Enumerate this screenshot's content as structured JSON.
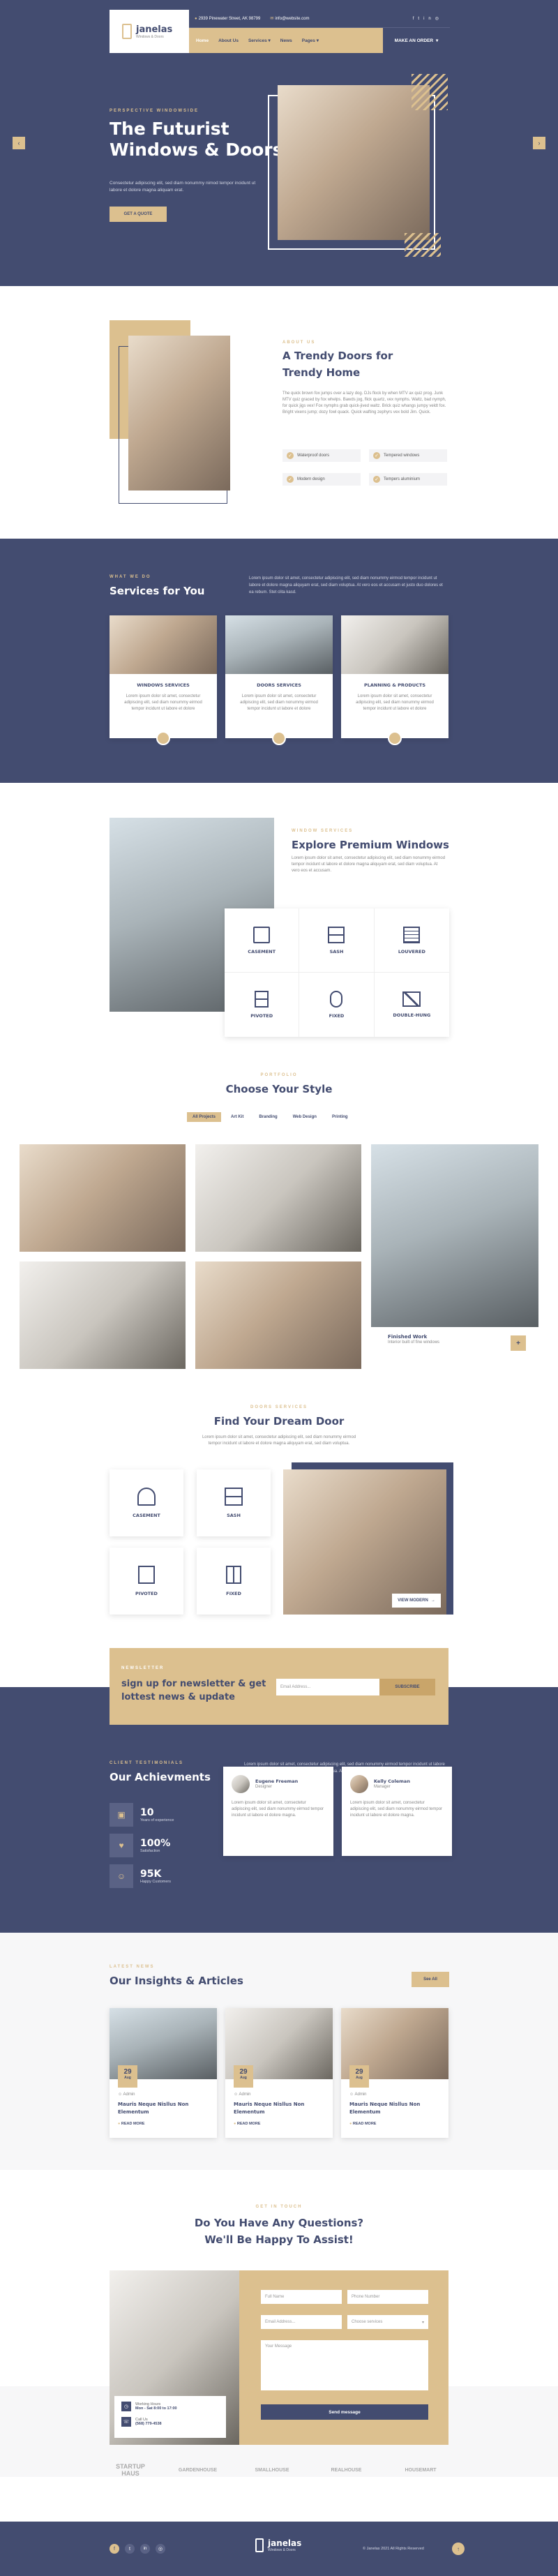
{
  "header": {
    "address": "2939 Pinewater Street, AK 98799",
    "email": "info@website.com",
    "logo_name": "janelas",
    "logo_tag": "Windows & Doors",
    "nav": [
      "Home",
      "About Us",
      "Services",
      "News",
      "Pages"
    ],
    "cta": "MAKE AN ORDER"
  },
  "hero": {
    "eyebrow": "PERSPECTIVE WINDOWSIDE",
    "title_line1": "The Futurist",
    "title_line2": "Windows & Doors",
    "text": "Consectetur adipiscing elit, sed diam nonummy nimod tempor incidunt ut labore et dolore magna aliquam erat.",
    "button": "GET A QUOTE"
  },
  "about": {
    "eyebrow": "ABOUT US",
    "title_line1": "A Trendy Doors for",
    "title_line2": "Trendy Home",
    "text": "The quick brown fox jumps over a lazy dog. DJs flock by when MTV ax quiz prog. Junk MTV quiz graced by fox whelps. Bawds jog, flick quartz, vex nymphs. Waltz, bad nymph, for quick jigs vex! Fox nymphs grab quick-jived waltz. Brick quiz whangs jumpy veldt fox. Bright vixens jump; dozy fowl quack. Quick wafting zephyrs vex bold Jim. Quick.",
    "features": [
      "Waterproof doors",
      "Tempered windows",
      "Modern design",
      "Tempers aluminium"
    ]
  },
  "services": {
    "eyebrow": "WHAT WE DO",
    "title": "Services for You",
    "intro": "Lorem ipsum dolor sit amet, consectetur adipiscing elit, sed diam nonummy eirmod tempor incidunt ut labore et dolore magna aliquyam erat, sed diam voluptua. At vero eos et accusam et justo duo dolores et ea rebum. Stet clita kasd.",
    "items": [
      {
        "name": "WINDOWS SERVICES",
        "text": "Lorem ipsum dolor sit amet, consectetur adipiscing elit, sed diam nonummy eirmod tempor incidunt ut labore et dolore"
      },
      {
        "name": "DOORS SERVICES",
        "text": "Lorem ipsum dolor sit amet, consectetur adipiscing elit, sed diam nonummy eirmod tempor incidunt ut labore et dolore"
      },
      {
        "name": "PLANNING & PRODUCTS",
        "text": "Lorem ipsum dolor sit amet, consectetur adipiscing elit, sed diam nonummy eirmod tempor incidunt ut labore et dolore"
      }
    ]
  },
  "premium": {
    "eyebrow": "WINDOW SERVICES",
    "title": "Explore Premium Windows",
    "text": "Lorem ipsum dolor sit amet, consectetur adipiscing elit, sed diam nonummy eirmod tempor incidunt ut labore et dolore magna aliquyam erat, sed diam voluptua. At vero eos et accusam.",
    "types": [
      "CASEMENT",
      "SASH",
      "LOUVERED",
      "PIVOTED",
      "FIXED",
      "DOUBLE-HUNG"
    ]
  },
  "portfolio": {
    "eyebrow": "PORTFOLIO",
    "title": "Choose Your Style",
    "filters": [
      "All Projects",
      "Art Kit",
      "Branding",
      "Web Design",
      "Printing"
    ],
    "caption_title": "Finished Work",
    "caption_text": "Interior built of fine windows"
  },
  "dream": {
    "eyebrow": "DOORS SERVICES",
    "title": "Find Your Dream Door",
    "text": "Lorem ipsum dolor sit amet, consectetur adipiscing elit, sed diam nonummy eirmod tempor incidunt ut labore et dolore magna aliquyam erat, sed diam voluptua.",
    "types": [
      "CASEMENT",
      "SASH",
      "PIVOTED",
      "FIXED"
    ],
    "view_button": "VIEW MODERN"
  },
  "newsletter": {
    "eyebrow": "NEWSLETTER",
    "title_line1": "sign up for newsletter & get",
    "title_line2": "lottest news & update",
    "placeholder": "Email Address...",
    "button": "SUBSCRIBE"
  },
  "achievements": {
    "eyebrow": "CLIENT TESTIMONIALS",
    "title": "Our Achievments",
    "intro": "Lorem ipsum dolor sit amet, consectetur adipiscing elit, sed diam nonummy eirmod tempor incidunt ut labore et dolore magna aliquyam erat, sed diam voluptua. At vero eos et accusam et justo duo dolores et ea rebum. Stet clita kasd.",
    "stats": [
      {
        "value": "10",
        "label": "Years of experience"
      },
      {
        "value": "100%",
        "label": "Satisfaction"
      },
      {
        "value": "95K",
        "label": "Happy Customers"
      }
    ],
    "testimonials": [
      {
        "name": "Eugene Freeman",
        "role": "Designer",
        "text": "Lorem ipsum dolor sit amet, consectetur adipiscing elit, sed diam nonummy eirmod tempor incidunt ut labore et dolore magna."
      },
      {
        "name": "Kelly Coleman",
        "role": "Manager",
        "text": "Lorem ipsum dolor sit amet, consectetur adipiscing elit, sed diam nonummy eirmod tempor incidunt ut labore et dolore magna."
      }
    ]
  },
  "blog": {
    "eyebrow": "LATEST NEWS",
    "title": "Our Insights & Articles",
    "see_all": "See All",
    "posts": [
      {
        "day": "29",
        "month": "Aug",
        "title": "Mauris Neque Nisllus Non Elementum",
        "meta": "Admin",
        "more": "READ MORE"
      },
      {
        "day": "29",
        "month": "Aug",
        "title": "Mauris Neque Nisllus Non Elementum",
        "meta": "Admin",
        "more": "READ MORE"
      },
      {
        "day": "29",
        "month": "Aug",
        "title": "Mauris Neque Nisllus Non Elementum",
        "meta": "Admin",
        "more": "READ MORE"
      }
    ]
  },
  "contact": {
    "eyebrow": "GET IN TOUCH",
    "title_line1": "Do You Have Any Questions?",
    "title_line2": "We'll Be Happy To Assist!",
    "hours_label": "Working Hours",
    "hours": "Mon - Sat 8:00 to 17:00",
    "call_label": "Call Us",
    "phone": "(568) 779-4538",
    "fields": [
      "Full Name",
      "Phone Number",
      "Email Address...",
      "Choose services",
      "Your Message"
    ],
    "button": "Send message"
  },
  "logos": [
    "STARTUP HAUS",
    "GARDENHOUSE",
    "SMALLHOUSE",
    "REALHOUSE",
    "HOUSEMART"
  ],
  "footer": {
    "logo_name": "janelas",
    "logo_tag": "Windows & Doors",
    "copyright": "© Janelas 2021 All Rights Reserved"
  }
}
